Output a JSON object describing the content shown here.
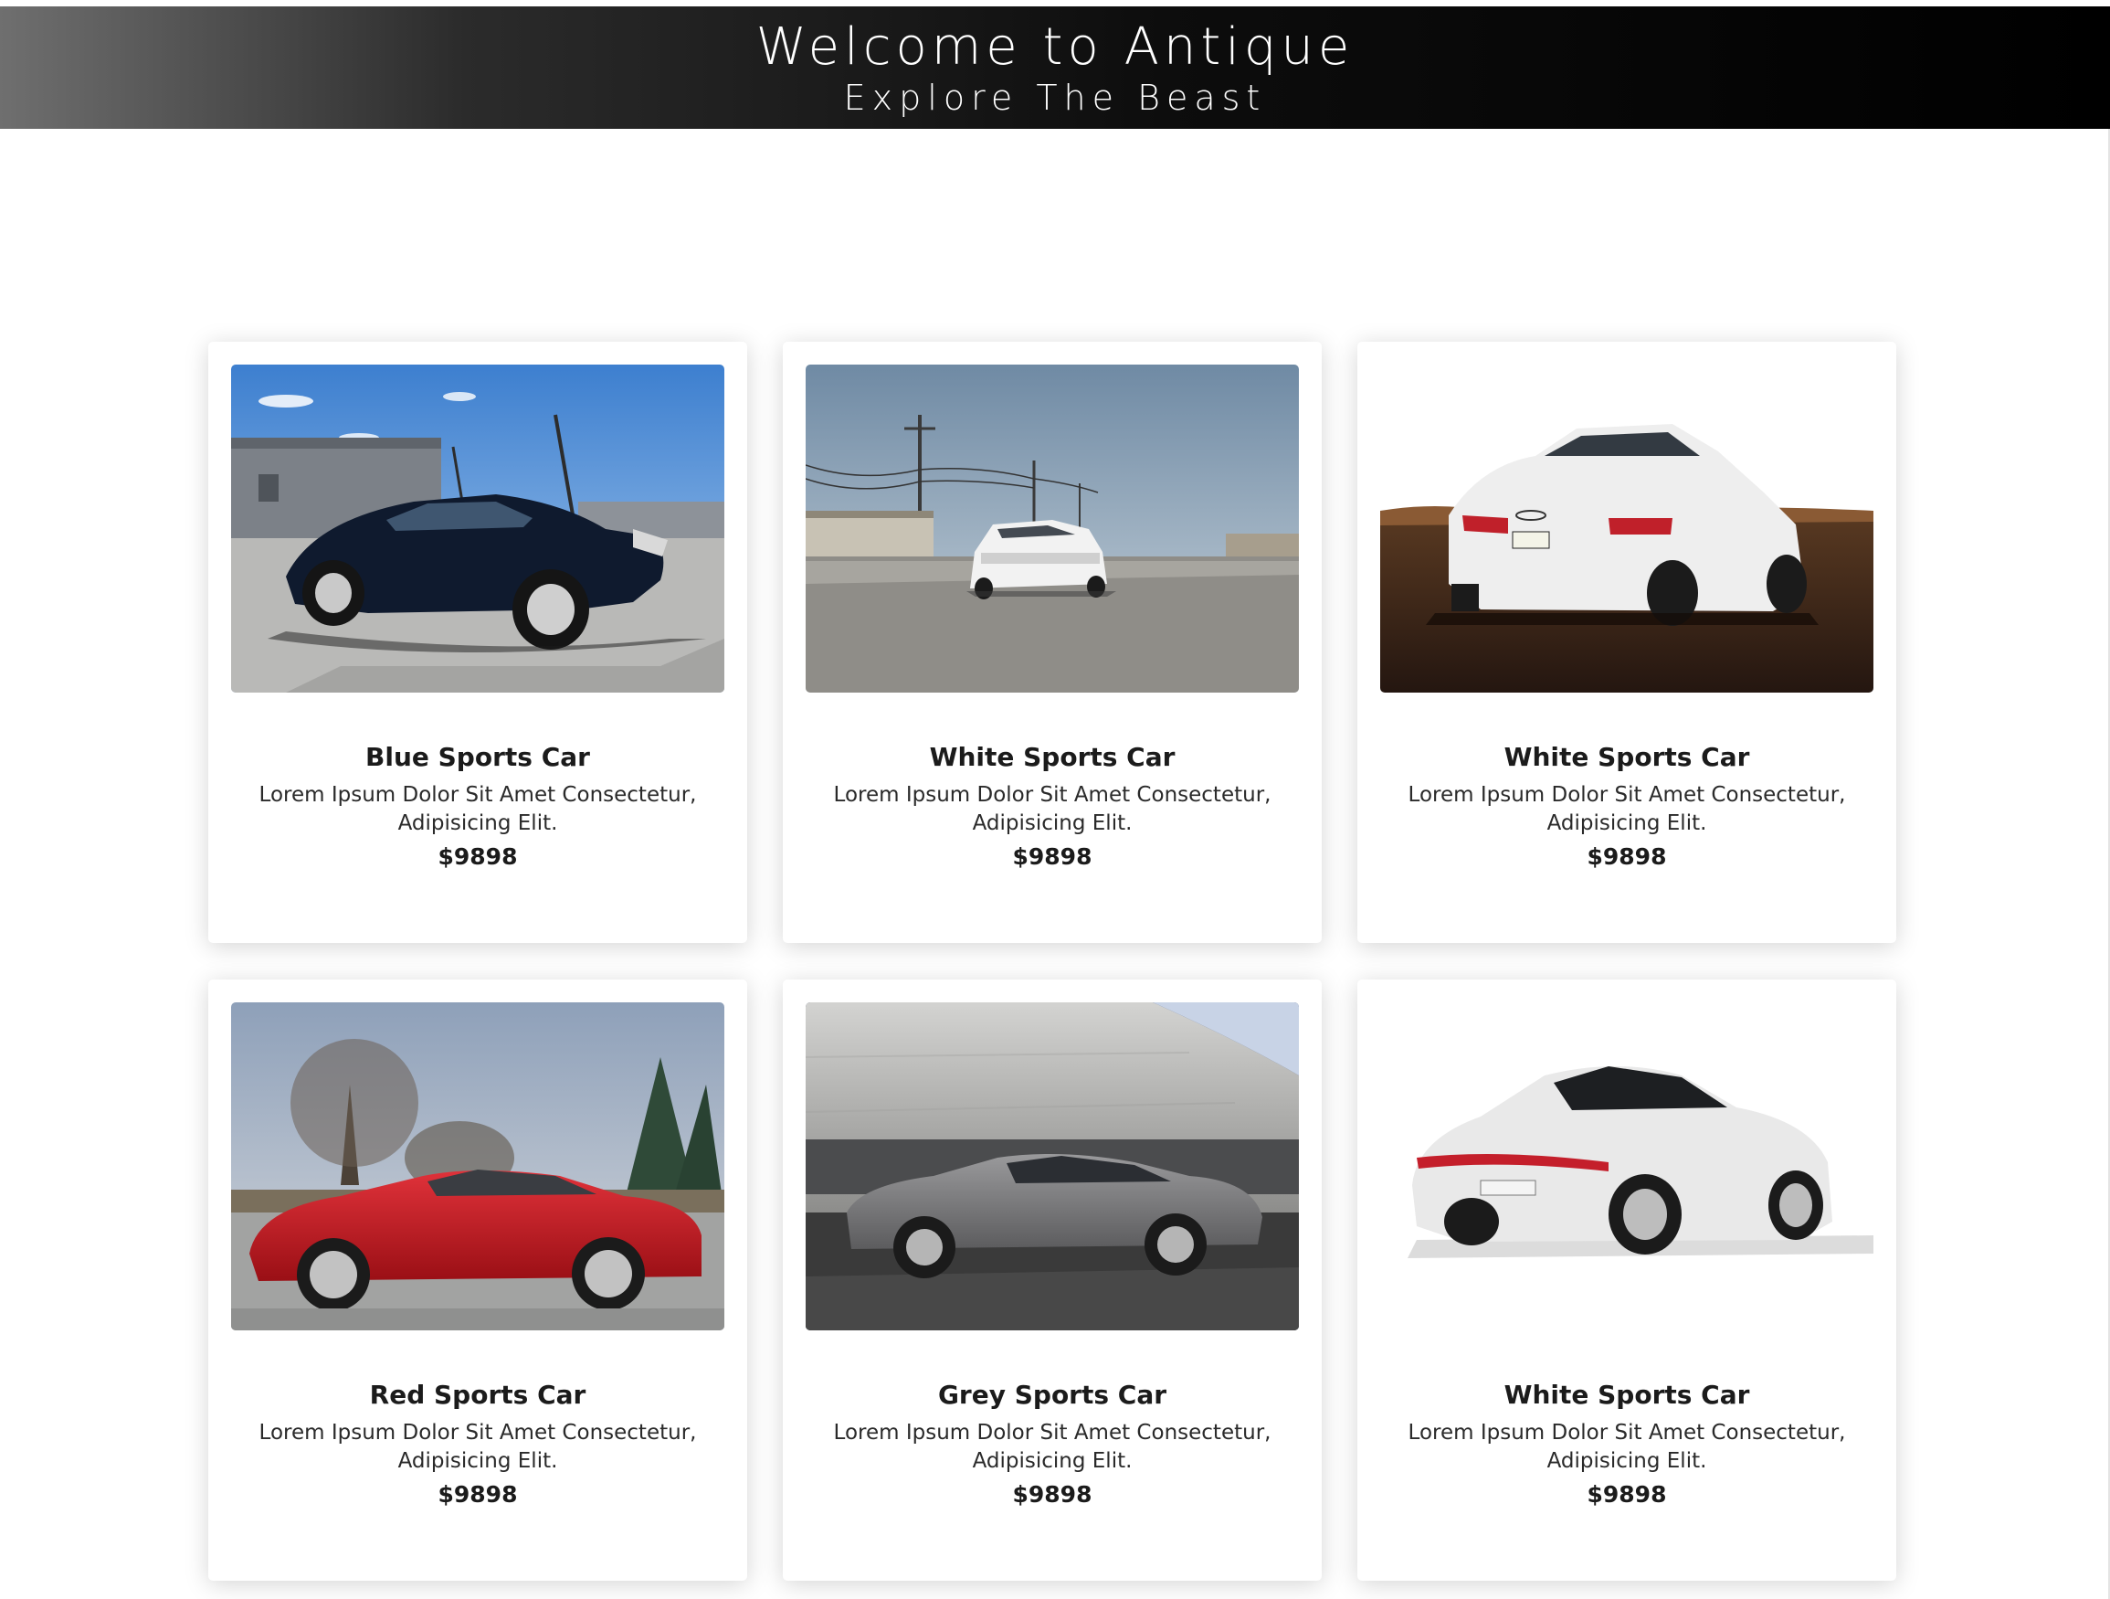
{
  "header": {
    "title": "Welcome to Antique",
    "subtitle": "Explore The Beast"
  },
  "cards": [
    {
      "title": "Blue Sports Car",
      "description": "Lorem Ipsum Dolor Sit Amet Consectetur, Adipisicing Elit.",
      "price": "$9898",
      "car_color": "#0f1a2e",
      "image": "blue-sedan-photo"
    },
    {
      "title": "White Sports Car",
      "description": "Lorem Ipsum Dolor Sit Amet Consectetur, Adipisicing Elit.",
      "price": "$9898",
      "car_color": "#f2f2f2",
      "image": "white-muscle-car-photo"
    },
    {
      "title": "White Sports Car",
      "description": "Lorem Ipsum Dolor Sit Amet Consectetur, Adipisicing Elit.",
      "price": "$9898",
      "car_color": "#eeeeee",
      "image": "white-sedan-rear-photo"
    },
    {
      "title": "Red Sports Car",
      "description": "Lorem Ipsum Dolor Sit Amet Consectetur, Adipisicing Elit.",
      "price": "$9898",
      "car_color": "#c0161c",
      "image": "red-sedan-photo"
    },
    {
      "title": "Grey Sports Car",
      "description": "Lorem Ipsum Dolor Sit Amet Consectetur, Adipisicing Elit.",
      "price": "$9898",
      "car_color": "#7a7a7c",
      "image": "grey-sedan-photo"
    },
    {
      "title": "White Sports Car",
      "description": "Lorem Ipsum Dolor Sit Amet Consectetur, Adipisicing Elit.",
      "price": "$9898",
      "car_color": "#e9e9e9",
      "image": "white-sedan-studio-photo"
    }
  ]
}
